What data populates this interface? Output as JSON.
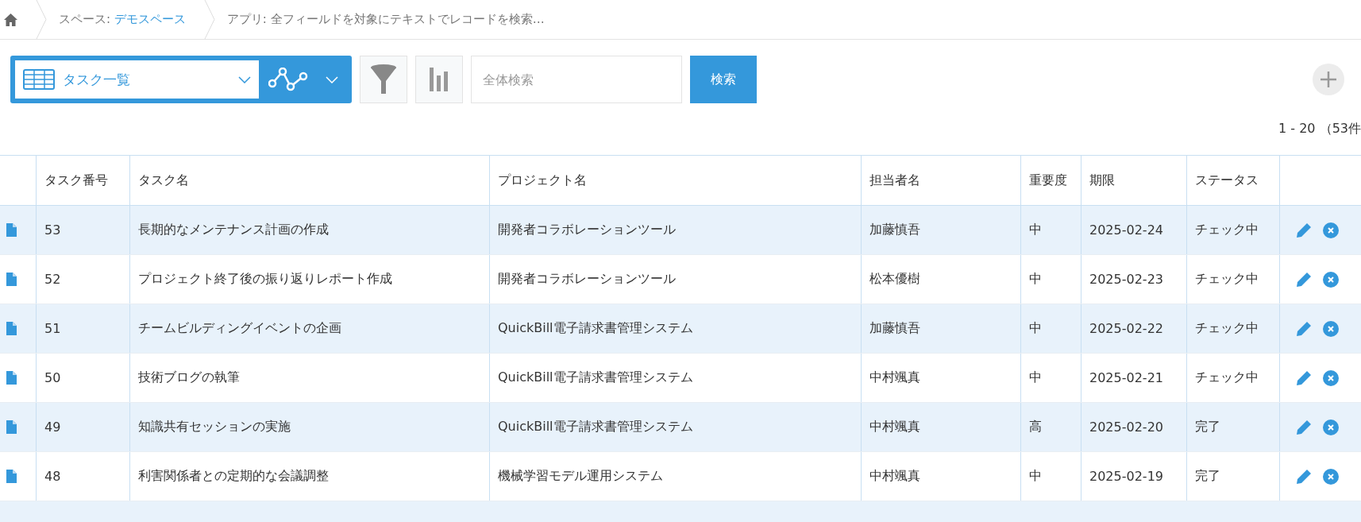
{
  "breadcrumb": [
    {
      "kind": "home"
    },
    {
      "kind": "space",
      "prefix": "スペース: ",
      "link": "デモスペース"
    },
    {
      "kind": "app",
      "text": "アプリ: 全フィールドを対象にテキストでレコードを検索…"
    }
  ],
  "toolbar": {
    "view": "タスク一覧",
    "search": {
      "placeholder": "全体検索"
    },
    "search_button": "検索"
  },
  "pagination": "1 - 20 （53件",
  "table": {
    "columns": [
      "タスク番号",
      "タスク名",
      "プロジェクト名",
      "担当者名",
      "重要度",
      "期限",
      "ステータス"
    ],
    "rows": [
      {
        "cells": [
          "53",
          "長期的なメンテナンス計画の作成",
          "開発者コラボレーションツール",
          "加藤慎吾",
          "中",
          "2025-02-24",
          "チェック中"
        ]
      },
      {
        "cells": [
          "52",
          "プロジェクト終了後の振り返りレポート作成",
          "開発者コラボレーションツール",
          "松本優樹",
          "中",
          "2025-02-23",
          "チェック中"
        ]
      },
      {
        "cells": [
          "51",
          "チームビルディングイベントの企画",
          "QuickBill電子請求書管理システム",
          "加藤慎吾",
          "中",
          "2025-02-22",
          "チェック中"
        ]
      },
      {
        "cells": [
          "50",
          "技術ブログの執筆",
          "QuickBill電子請求書管理システム",
          "中村颯真",
          "中",
          "2025-02-21",
          "チェック中"
        ]
      },
      {
        "cells": [
          "49",
          "知識共有セッションの実施",
          "QuickBill電子請求書管理システム",
          "中村颯真",
          "高",
          "2025-02-20",
          "完了"
        ]
      },
      {
        "cells": [
          "48",
          "利害関係者との定期的な会議調整",
          "機械学習モデル運用システム",
          "中村颯真",
          "中",
          "2025-02-19",
          "完了"
        ]
      }
    ]
  }
}
